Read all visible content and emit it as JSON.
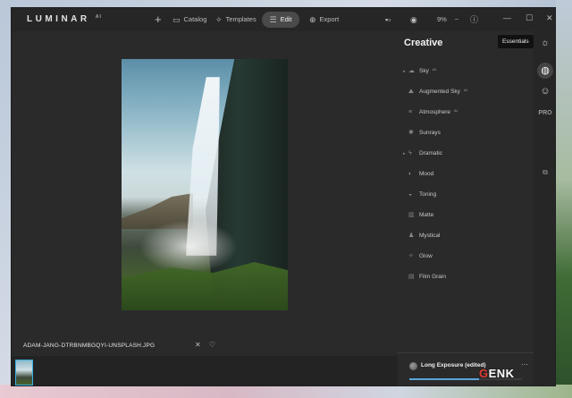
{
  "app": {
    "logo": "LUMINAR",
    "logo_version": "AI"
  },
  "toolbar": {
    "add_icon": "plus-icon",
    "catalog_label": "Catalog",
    "templates_label": "Templates",
    "edit_label": "Edit",
    "export_label": "Export",
    "zoom_value": "9%"
  },
  "image": {
    "filename": "ADAM-JANG-DTRBNMBGQYI-UNSPLASH.JPG"
  },
  "panel": {
    "title": "Creative",
    "tools": [
      {
        "label": "Sky",
        "badge": "AI",
        "expandable": true,
        "icon": "cloud-icon"
      },
      {
        "label": "Augmented Sky",
        "badge": "AI",
        "expandable": false,
        "icon": "cloud-mountain-icon"
      },
      {
        "label": "Atmosphere",
        "badge": "AI",
        "expandable": false,
        "icon": "lines-icon"
      },
      {
        "label": "Sunrays",
        "badge": "",
        "expandable": false,
        "icon": "sun-icon"
      },
      {
        "label": "Dramatic",
        "badge": "",
        "expandable": true,
        "icon": "bolt-icon"
      },
      {
        "label": "Mood",
        "badge": "",
        "expandable": false,
        "icon": "mood-icon"
      },
      {
        "label": "Toning",
        "badge": "",
        "expandable": false,
        "icon": "drop-icon"
      },
      {
        "label": "Matte",
        "badge": "",
        "expandable": false,
        "icon": "matte-icon"
      },
      {
        "label": "Mystical",
        "badge": "",
        "expandable": false,
        "icon": "figure-icon"
      },
      {
        "label": "Glow",
        "badge": "",
        "expandable": false,
        "icon": "glow-icon"
      },
      {
        "label": "Film Grain",
        "badge": "",
        "expandable": false,
        "icon": "film-icon"
      }
    ],
    "look": {
      "name": "Long Exposure (edited)",
      "amount": 0.62
    }
  },
  "rail": {
    "tooltip": "Essentials",
    "pro_label": "PRO"
  },
  "watermark": {
    "prefix": "G",
    "rest": "ENK"
  },
  "colors": {
    "accent": "#3ab1e0",
    "window_bg": "#2a2a2a"
  }
}
